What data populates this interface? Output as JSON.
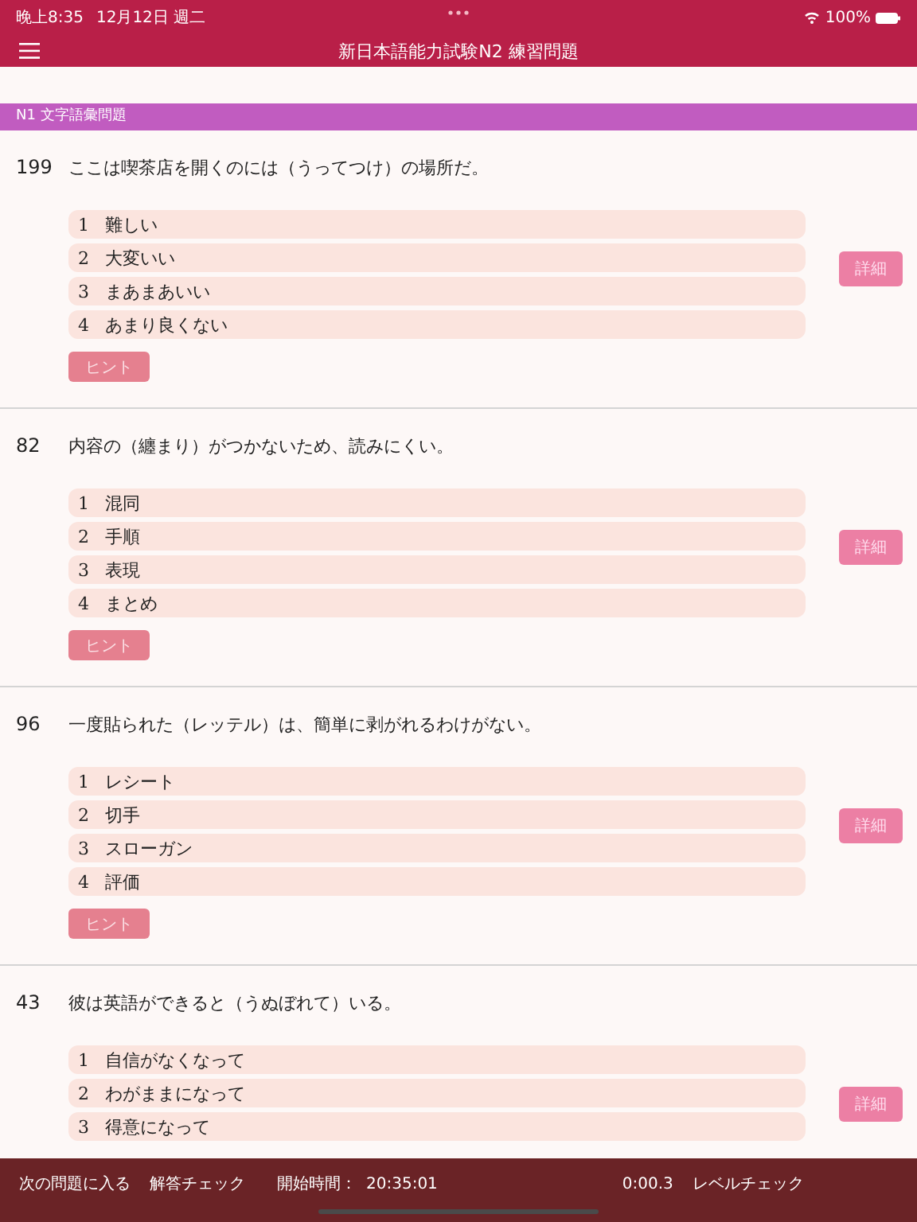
{
  "status_bar": {
    "time": "晚上8:35",
    "date": "12月12日 週二",
    "battery": "100%"
  },
  "nav_bar": {
    "title": "新日本語能力試験N2 練習問題"
  },
  "section": {
    "title": "N1 文字語彙問題"
  },
  "questions": [
    {
      "number": "199",
      "text": "ここは喫茶店を開くのには（うってつけ）の場所だ。",
      "options": [
        {
          "number": "1",
          "label": "難しい"
        },
        {
          "number": "2",
          "label": "大変いい"
        },
        {
          "number": "3",
          "label": "まあまあいい"
        },
        {
          "number": "4",
          "label": "あまり良くない"
        }
      ],
      "detail_button": "詳細",
      "hint_button": "ヒント"
    },
    {
      "number": "82",
      "text": "内容の（纏まり）がつかないため、読みにくい。",
      "options": [
        {
          "number": "1",
          "label": "混同"
        },
        {
          "number": "2",
          "label": "手順"
        },
        {
          "number": "3",
          "label": "表現"
        },
        {
          "number": "4",
          "label": "まとめ"
        }
      ],
      "detail_button": "詳細",
      "hint_button": "ヒント"
    },
    {
      "number": "96",
      "text": "一度貼られた（レッテル）は、簡単に剥がれるわけがない。",
      "options": [
        {
          "number": "1",
          "label": "レシート"
        },
        {
          "number": "2",
          "label": "切手"
        },
        {
          "number": "3",
          "label": "スローガン"
        },
        {
          "number": "4",
          "label": "評価"
        }
      ],
      "detail_button": "詳細",
      "hint_button": "ヒント"
    },
    {
      "number": "43",
      "text": "彼は英語ができると（うぬぼれて）いる。",
      "options": [
        {
          "number": "1",
          "label": "自信がなくなって"
        },
        {
          "number": "2",
          "label": "わがままになって"
        },
        {
          "number": "3",
          "label": "得意になって"
        }
      ],
      "detail_button": "詳細"
    }
  ],
  "bottom_bar": {
    "next_button": "次の問題に入る",
    "check_button": "解答チェック",
    "start_label": "開始時間：",
    "start_time": "20:35:01",
    "elapsed": "0:00.3",
    "level_button": "レベルチェック"
  }
}
